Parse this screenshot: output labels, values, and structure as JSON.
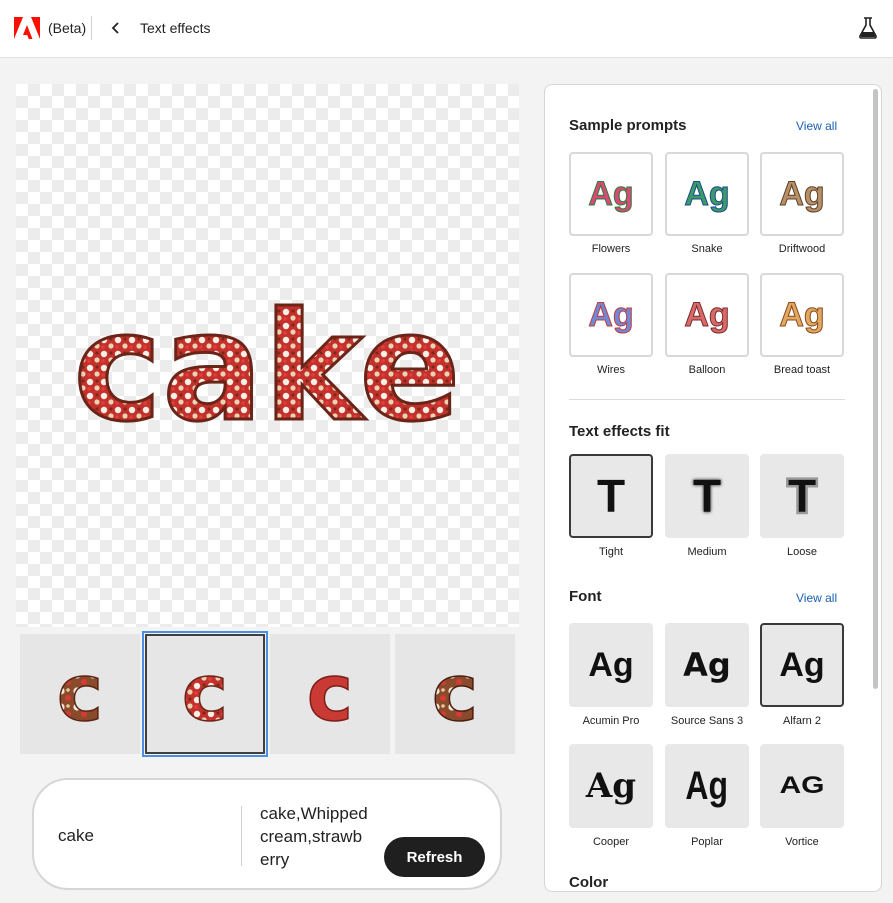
{
  "header": {
    "beta_label": "(Beta)",
    "title": "Text effects",
    "brand_color": "#fa0f00"
  },
  "canvas": {
    "word": "cake"
  },
  "thumbnails": {
    "letter": "c",
    "selected_index": 1,
    "count": 4
  },
  "prompt": {
    "text_value": "cake",
    "description": "cake,Whipped cream,strawberry",
    "refresh_label": "Refresh"
  },
  "panel": {
    "sample_prompts": {
      "title": "Sample prompts",
      "view_all": "View all",
      "items": [
        {
          "label": "Flowers",
          "glyph": "Ag"
        },
        {
          "label": "Snake",
          "glyph": "Ag"
        },
        {
          "label": "Driftwood",
          "glyph": "Ag"
        },
        {
          "label": "Wires",
          "glyph": "Ag"
        },
        {
          "label": "Balloon",
          "glyph": "Ag"
        },
        {
          "label": "Bread toast",
          "glyph": "Ag"
        }
      ]
    },
    "fit": {
      "title": "Text effects fit",
      "items": [
        {
          "label": "Tight",
          "glyph": "T"
        },
        {
          "label": "Medium",
          "glyph": "T"
        },
        {
          "label": "Loose",
          "glyph": "T"
        }
      ],
      "selected_index": 0
    },
    "font": {
      "title": "Font",
      "view_all": "View all",
      "items": [
        {
          "label": "Acumin Pro",
          "glyph": "Ag"
        },
        {
          "label": "Source Sans 3",
          "glyph": "Ag"
        },
        {
          "label": "Alfarn 2",
          "glyph": "Ag"
        },
        {
          "label": "Cooper",
          "glyph": "Ag"
        },
        {
          "label": "Poplar",
          "glyph": "Ag"
        },
        {
          "label": "Vortice",
          "glyph": "AG"
        }
      ],
      "selected_index": 2
    },
    "color": {
      "title": "Color"
    }
  }
}
